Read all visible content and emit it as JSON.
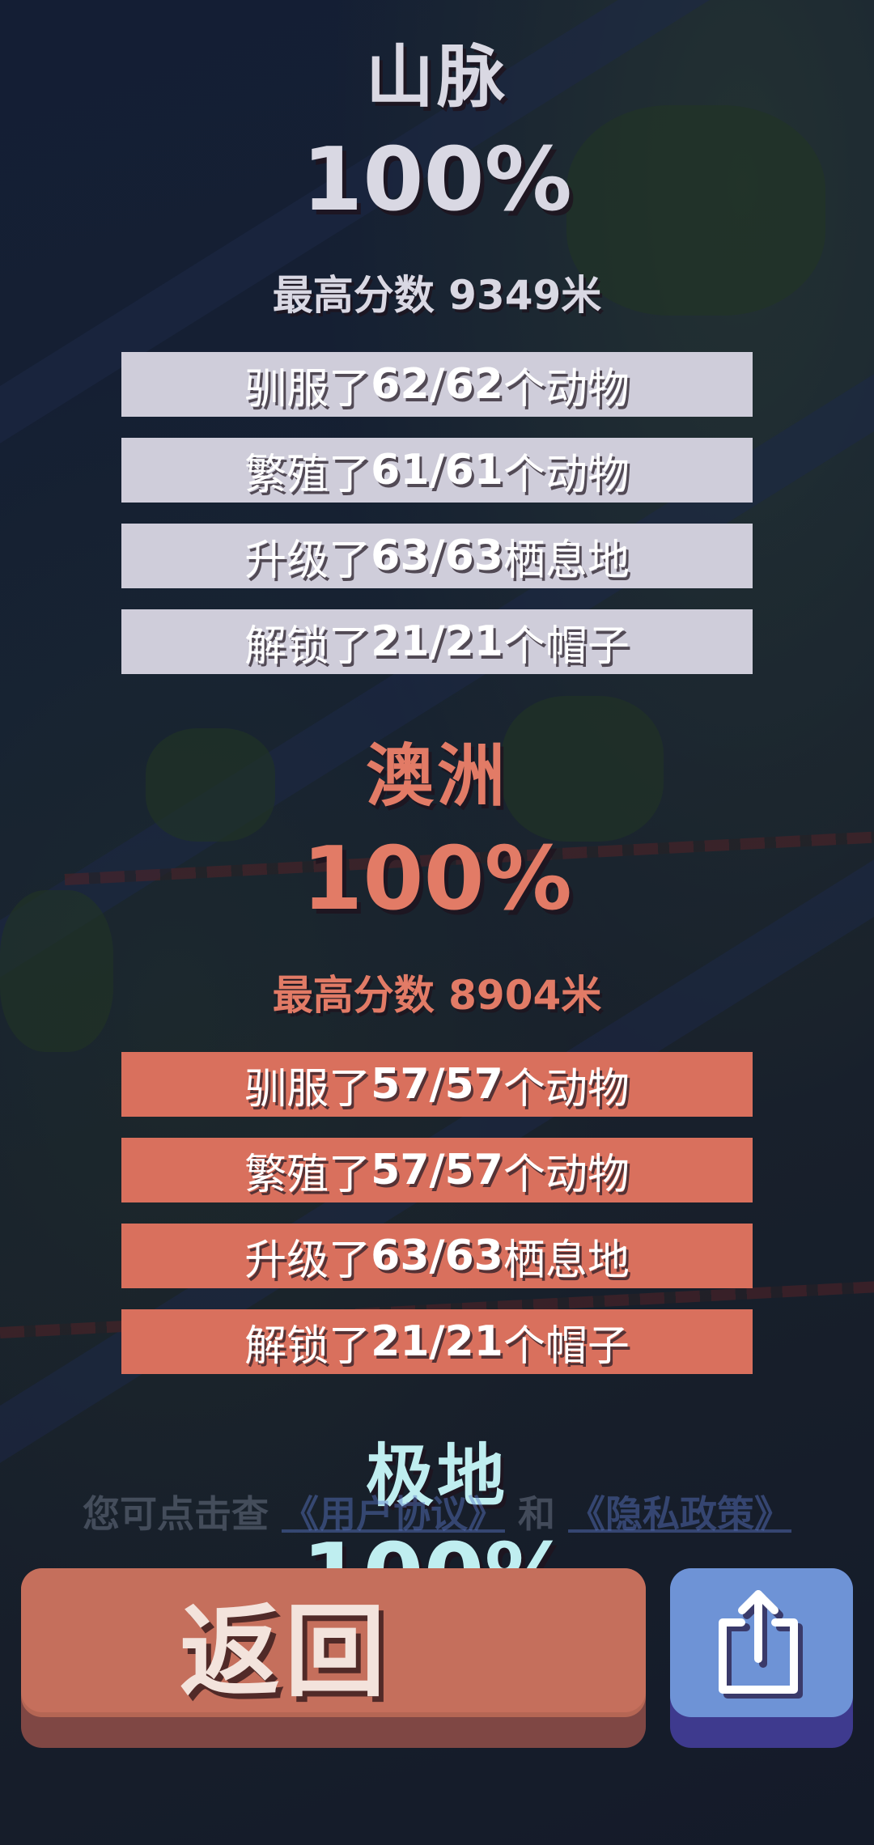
{
  "regions": [
    {
      "name": "山脉",
      "percent": "100%",
      "best_score": "最高分数 9349米",
      "stats": [
        {
          "prefix": "驯服了",
          "value": "62/62",
          "suffix": "个动物"
        },
        {
          "prefix": "繁殖了",
          "value": "61/61",
          "suffix": "个动物"
        },
        {
          "prefix": "升级了",
          "value": "63/63",
          "suffix": "栖息地"
        },
        {
          "prefix": "解锁了",
          "value": "21/21",
          "suffix": "个帽子"
        }
      ]
    },
    {
      "name": "澳洲",
      "percent": "100%",
      "best_score": "最高分数 8904米",
      "stats": [
        {
          "prefix": "驯服了",
          "value": "57/57",
          "suffix": "个动物"
        },
        {
          "prefix": "繁殖了",
          "value": "57/57",
          "suffix": "个动物"
        },
        {
          "prefix": "升级了",
          "value": "63/63",
          "suffix": "栖息地"
        },
        {
          "prefix": "解锁了",
          "value": "21/21",
          "suffix": "个帽子"
        }
      ]
    },
    {
      "name": "极地",
      "percent": "100%"
    }
  ],
  "legal": {
    "prefix": "您可点击查",
    "terms_link": "《用户协议》",
    "joiner": "和",
    "privacy_link": "《隐私政策》"
  },
  "buttons": {
    "back_label": "返回",
    "share_icon": "share-icon"
  },
  "colors": {
    "mountain": "#d9d8e3",
    "australia": "#d9705d",
    "polar": "#bfeef0",
    "back_button": "#c56f5c",
    "share_button": "#6e93d6"
  }
}
